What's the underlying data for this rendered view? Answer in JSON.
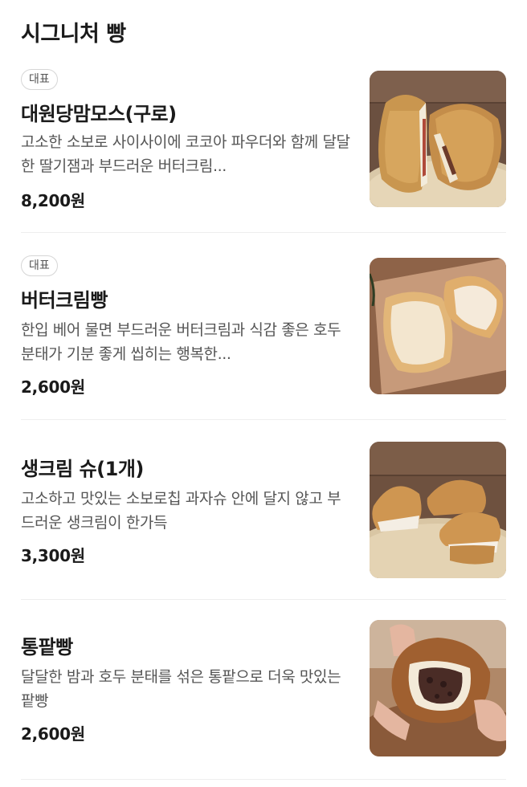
{
  "section": {
    "title": "시그니처 빵"
  },
  "items": [
    {
      "badge": "대표",
      "name": "대원당맘모스(구로)",
      "description": "고소한 소보로 사이사이에 코코아 파우더와 함께 달달한 딸기잼과 부드러운 버터크림...",
      "price": "8,200원",
      "image_icon": "mammoth-bread-photo"
    },
    {
      "badge": "대표",
      "name": "버터크림빵",
      "description": "한입 베어 물면 부드러운 버터크림과 식감 좋은 호두분태가 기분 좋게 씹히는 행복한...",
      "price": "2,600원",
      "image_icon": "butter-cream-bread-photo"
    },
    {
      "name": "생크림 슈(1개)",
      "description": "고소하고 맛있는 소보로칩 과자슈 안에 달지 않고 부드러운 생크림이 한가득",
      "price": "3,300원",
      "image_icon": "cream-puff-photo"
    },
    {
      "name": "통팥빵",
      "description": "달달한 밤과 호두 분태를 섞은 통팥으로 더욱 맛있는 팥빵",
      "price": "2,600원",
      "image_icon": "red-bean-bread-photo"
    }
  ],
  "colors": {
    "text_primary": "#1a1a1a",
    "text_secondary": "#555555",
    "divider": "#eeeeee",
    "badge_border": "#d6d6d6"
  }
}
